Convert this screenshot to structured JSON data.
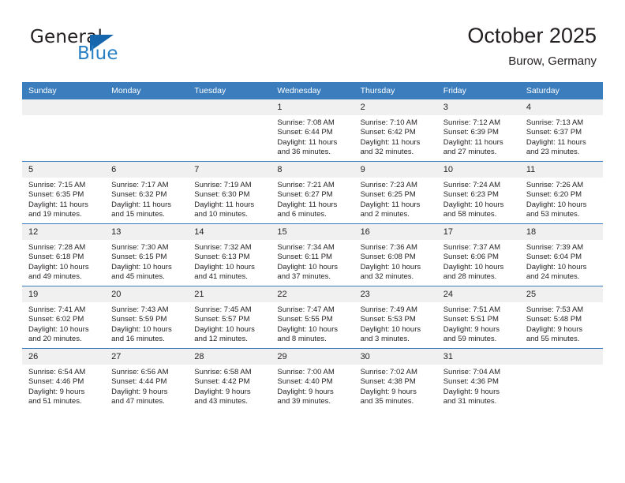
{
  "logo": {
    "word_one": "General",
    "word_two": "Blue",
    "icon": "triangle-logo-icon",
    "color_primary": "#1666ad",
    "color_secondary": "#2980c4"
  },
  "header": {
    "title": "October 2025",
    "subtitle": "Burow, Germany"
  },
  "colors": {
    "header_blue": "#3b7dbd",
    "daynum_band": "#f0f0f0",
    "text": "#231f20"
  },
  "calendar": {
    "weekday_headers": [
      "Sunday",
      "Monday",
      "Tuesday",
      "Wednesday",
      "Thursday",
      "Friday",
      "Saturday"
    ],
    "weeks": [
      [
        {
          "day": "",
          "empty": true,
          "sunrise": "",
          "sunset": "",
          "daylight": "",
          "daylight2": ""
        },
        {
          "day": "",
          "empty": true,
          "sunrise": "",
          "sunset": "",
          "daylight": "",
          "daylight2": ""
        },
        {
          "day": "",
          "empty": true,
          "sunrise": "",
          "sunset": "",
          "daylight": "",
          "daylight2": ""
        },
        {
          "day": "1",
          "sunrise": "Sunrise: 7:08 AM",
          "sunset": "Sunset: 6:44 PM",
          "daylight": "Daylight: 11 hours",
          "daylight2": "and 36 minutes."
        },
        {
          "day": "2",
          "sunrise": "Sunrise: 7:10 AM",
          "sunset": "Sunset: 6:42 PM",
          "daylight": "Daylight: 11 hours",
          "daylight2": "and 32 minutes."
        },
        {
          "day": "3",
          "sunrise": "Sunrise: 7:12 AM",
          "sunset": "Sunset: 6:39 PM",
          "daylight": "Daylight: 11 hours",
          "daylight2": "and 27 minutes."
        },
        {
          "day": "4",
          "sunrise": "Sunrise: 7:13 AM",
          "sunset": "Sunset: 6:37 PM",
          "daylight": "Daylight: 11 hours",
          "daylight2": "and 23 minutes."
        }
      ],
      [
        {
          "day": "5",
          "sunrise": "Sunrise: 7:15 AM",
          "sunset": "Sunset: 6:35 PM",
          "daylight": "Daylight: 11 hours",
          "daylight2": "and 19 minutes."
        },
        {
          "day": "6",
          "sunrise": "Sunrise: 7:17 AM",
          "sunset": "Sunset: 6:32 PM",
          "daylight": "Daylight: 11 hours",
          "daylight2": "and 15 minutes."
        },
        {
          "day": "7",
          "sunrise": "Sunrise: 7:19 AM",
          "sunset": "Sunset: 6:30 PM",
          "daylight": "Daylight: 11 hours",
          "daylight2": "and 10 minutes."
        },
        {
          "day": "8",
          "sunrise": "Sunrise: 7:21 AM",
          "sunset": "Sunset: 6:27 PM",
          "daylight": "Daylight: 11 hours",
          "daylight2": "and 6 minutes."
        },
        {
          "day": "9",
          "sunrise": "Sunrise: 7:23 AM",
          "sunset": "Sunset: 6:25 PM",
          "daylight": "Daylight: 11 hours",
          "daylight2": "and 2 minutes."
        },
        {
          "day": "10",
          "sunrise": "Sunrise: 7:24 AM",
          "sunset": "Sunset: 6:23 PM",
          "daylight": "Daylight: 10 hours",
          "daylight2": "and 58 minutes."
        },
        {
          "day": "11",
          "sunrise": "Sunrise: 7:26 AM",
          "sunset": "Sunset: 6:20 PM",
          "daylight": "Daylight: 10 hours",
          "daylight2": "and 53 minutes."
        }
      ],
      [
        {
          "day": "12",
          "sunrise": "Sunrise: 7:28 AM",
          "sunset": "Sunset: 6:18 PM",
          "daylight": "Daylight: 10 hours",
          "daylight2": "and 49 minutes."
        },
        {
          "day": "13",
          "sunrise": "Sunrise: 7:30 AM",
          "sunset": "Sunset: 6:15 PM",
          "daylight": "Daylight: 10 hours",
          "daylight2": "and 45 minutes."
        },
        {
          "day": "14",
          "sunrise": "Sunrise: 7:32 AM",
          "sunset": "Sunset: 6:13 PM",
          "daylight": "Daylight: 10 hours",
          "daylight2": "and 41 minutes."
        },
        {
          "day": "15",
          "sunrise": "Sunrise: 7:34 AM",
          "sunset": "Sunset: 6:11 PM",
          "daylight": "Daylight: 10 hours",
          "daylight2": "and 37 minutes."
        },
        {
          "day": "16",
          "sunrise": "Sunrise: 7:36 AM",
          "sunset": "Sunset: 6:08 PM",
          "daylight": "Daylight: 10 hours",
          "daylight2": "and 32 minutes."
        },
        {
          "day": "17",
          "sunrise": "Sunrise: 7:37 AM",
          "sunset": "Sunset: 6:06 PM",
          "daylight": "Daylight: 10 hours",
          "daylight2": "and 28 minutes."
        },
        {
          "day": "18",
          "sunrise": "Sunrise: 7:39 AM",
          "sunset": "Sunset: 6:04 PM",
          "daylight": "Daylight: 10 hours",
          "daylight2": "and 24 minutes."
        }
      ],
      [
        {
          "day": "19",
          "sunrise": "Sunrise: 7:41 AM",
          "sunset": "Sunset: 6:02 PM",
          "daylight": "Daylight: 10 hours",
          "daylight2": "and 20 minutes."
        },
        {
          "day": "20",
          "sunrise": "Sunrise: 7:43 AM",
          "sunset": "Sunset: 5:59 PM",
          "daylight": "Daylight: 10 hours",
          "daylight2": "and 16 minutes."
        },
        {
          "day": "21",
          "sunrise": "Sunrise: 7:45 AM",
          "sunset": "Sunset: 5:57 PM",
          "daylight": "Daylight: 10 hours",
          "daylight2": "and 12 minutes."
        },
        {
          "day": "22",
          "sunrise": "Sunrise: 7:47 AM",
          "sunset": "Sunset: 5:55 PM",
          "daylight": "Daylight: 10 hours",
          "daylight2": "and 8 minutes."
        },
        {
          "day": "23",
          "sunrise": "Sunrise: 7:49 AM",
          "sunset": "Sunset: 5:53 PM",
          "daylight": "Daylight: 10 hours",
          "daylight2": "and 3 minutes."
        },
        {
          "day": "24",
          "sunrise": "Sunrise: 7:51 AM",
          "sunset": "Sunset: 5:51 PM",
          "daylight": "Daylight: 9 hours",
          "daylight2": "and 59 minutes."
        },
        {
          "day": "25",
          "sunrise": "Sunrise: 7:53 AM",
          "sunset": "Sunset: 5:48 PM",
          "daylight": "Daylight: 9 hours",
          "daylight2": "and 55 minutes."
        }
      ],
      [
        {
          "day": "26",
          "sunrise": "Sunrise: 6:54 AM",
          "sunset": "Sunset: 4:46 PM",
          "daylight": "Daylight: 9 hours",
          "daylight2": "and 51 minutes."
        },
        {
          "day": "27",
          "sunrise": "Sunrise: 6:56 AM",
          "sunset": "Sunset: 4:44 PM",
          "daylight": "Daylight: 9 hours",
          "daylight2": "and 47 minutes."
        },
        {
          "day": "28",
          "sunrise": "Sunrise: 6:58 AM",
          "sunset": "Sunset: 4:42 PM",
          "daylight": "Daylight: 9 hours",
          "daylight2": "and 43 minutes."
        },
        {
          "day": "29",
          "sunrise": "Sunrise: 7:00 AM",
          "sunset": "Sunset: 4:40 PM",
          "daylight": "Daylight: 9 hours",
          "daylight2": "and 39 minutes."
        },
        {
          "day": "30",
          "sunrise": "Sunrise: 7:02 AM",
          "sunset": "Sunset: 4:38 PM",
          "daylight": "Daylight: 9 hours",
          "daylight2": "and 35 minutes."
        },
        {
          "day": "31",
          "sunrise": "Sunrise: 7:04 AM",
          "sunset": "Sunset: 4:36 PM",
          "daylight": "Daylight: 9 hours",
          "daylight2": "and 31 minutes."
        },
        {
          "day": "",
          "empty": true,
          "sunrise": "",
          "sunset": "",
          "daylight": "",
          "daylight2": ""
        }
      ]
    ]
  }
}
